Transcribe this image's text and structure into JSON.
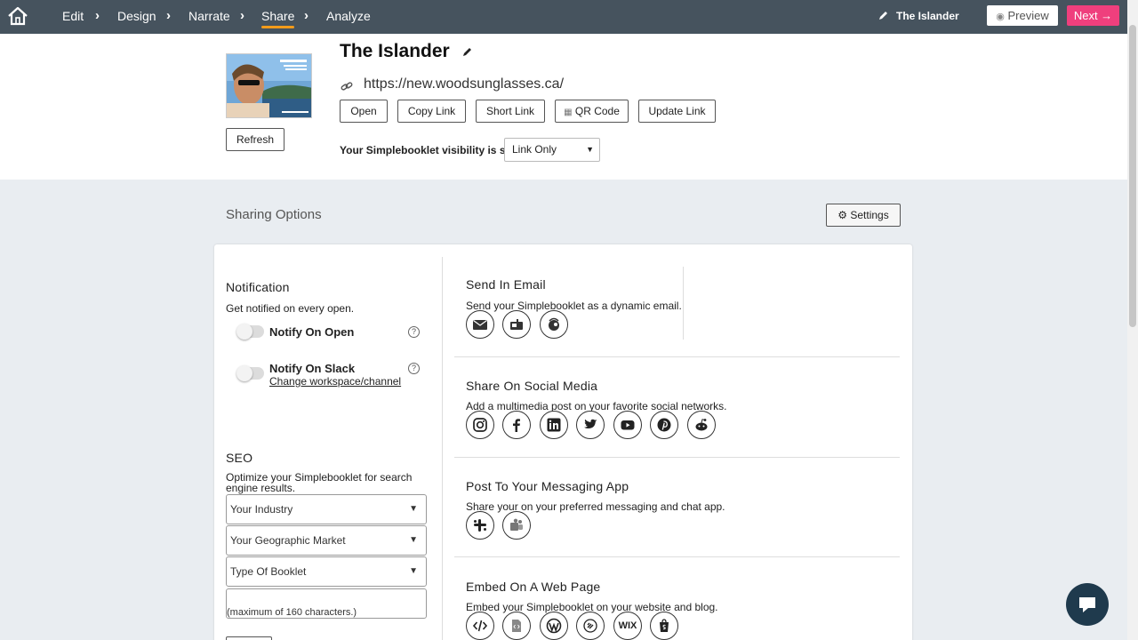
{
  "nav": {
    "steps": [
      "Edit",
      "Design",
      "Narrate",
      "Share",
      "Analyze"
    ],
    "active_step": "Share",
    "booklet_title": "The Islander",
    "preview_label": "Preview",
    "next_label": "Next →"
  },
  "header": {
    "title": "The Islander",
    "url": "https://new.woodsunglasses.ca/",
    "buttons": {
      "open": "Open",
      "copy_link": "Copy Link",
      "short_link": "Short Link",
      "qr_code": "QR Code",
      "update_link": "Update Link",
      "refresh": "Refresh"
    },
    "visibility_label": "Your Simplebooklet visibility is set to",
    "visibility_value": "Link Only"
  },
  "sharing": {
    "heading": "Sharing Options",
    "settings_label": "Settings"
  },
  "notification": {
    "title": "Notification",
    "desc": "Get notified on every open.",
    "notify_open": "Notify On Open",
    "notify_slack": "Notify On Slack",
    "change_workspace": "Change workspace/channel",
    "help": "?"
  },
  "seo": {
    "title": "SEO",
    "desc": "Optimize your Simplebooklet for search engine results.",
    "industry_placeholder": "Your Industry",
    "market_placeholder": "Your Geographic Market",
    "type_placeholder": "Type Of Booklet",
    "description_hint": "(maximum of 160 characters.)"
  },
  "email": {
    "title": "Send In Email",
    "desc": "Send your Simplebooklet as a dynamic email."
  },
  "social": {
    "title": "Share On Social Media",
    "desc": "Add a multimedia post on your favorite social networks."
  },
  "messaging": {
    "title": "Post To Your Messaging App",
    "desc": "Share your on your preferred messaging and chat app."
  },
  "embed": {
    "title": "Embed On A Web Page",
    "desc": "Embed your Simplebooklet on your website and blog.",
    "wix_label": "WIX"
  },
  "colors": {
    "topbar": "#46535e",
    "accent_orange": "#f39b1a",
    "next_pink": "#ef3f7d",
    "chat_bg": "#1f3a4d"
  }
}
